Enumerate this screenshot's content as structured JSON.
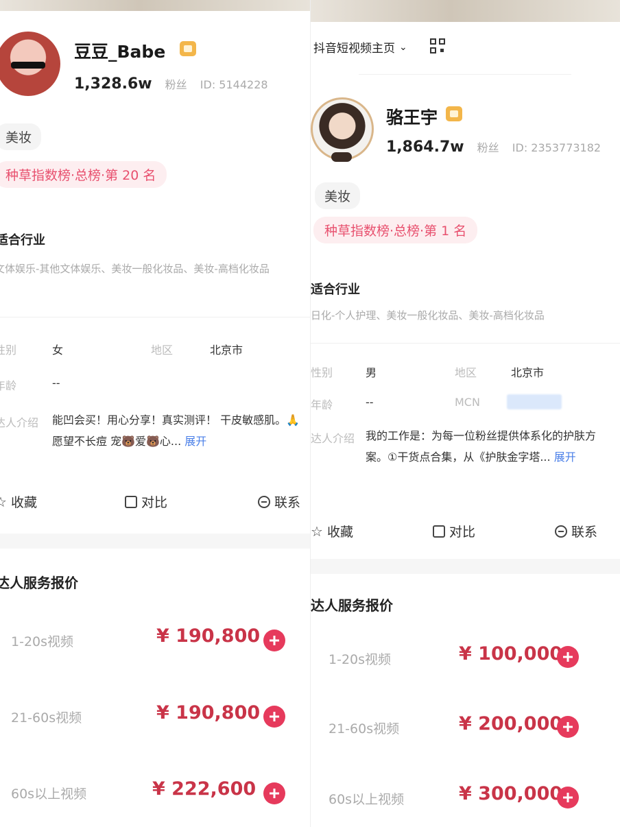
{
  "left": {
    "name": "豆豆_Babe",
    "fans_count": "1,328.6w",
    "fans_label": "粉丝",
    "id_text": "ID: 5144228",
    "category_tag": "美妆",
    "rank_badge": "种草指数榜·总榜·第 20 名",
    "industry_title": "适合行业",
    "industry_text": "文体娱乐-其他文体娱乐、美妆一般化妆品、美妆-高档化妆品",
    "info": {
      "gender_label": "性别",
      "gender_value": "女",
      "region_label": "地区",
      "region_value": "北京市",
      "age_label": "年龄",
      "age_value": "--",
      "intro_label": "达人介绍",
      "intro_text": "能凹会买！用心分享！真实测评！ 干皮敏感肌。🙏愿望不长痘 宠🐻爱🐻心...",
      "expand": "展开"
    },
    "actions": {
      "collect": "收藏",
      "compare": "对比",
      "contact": "联系"
    },
    "pricing_title": "达人服务报价",
    "prices": [
      {
        "label": "1-20s视频",
        "value": "¥ 190,800"
      },
      {
        "label": "21-60s视频",
        "value": "¥ 190,800"
      },
      {
        "label": "60s以上视频",
        "value": "¥ 222,600"
      }
    ]
  },
  "right": {
    "nav_title": "抖音短视频主页",
    "name": "骆王宇",
    "fans_count": "1,864.7w",
    "fans_label": "粉丝",
    "id_text": "ID: 2353773182",
    "category_tag": "美妆",
    "rank_badge": "种草指数榜·总榜·第 1 名",
    "industry_title": "适合行业",
    "industry_text": "日化-个人护理、美妆一般化妆品、美妆-高档化妆品",
    "info": {
      "gender_label": "性别",
      "gender_value": "男",
      "region_label": "地区",
      "region_value": "北京市",
      "age_label": "年龄",
      "age_value": "--",
      "mcn_label": "MCN",
      "intro_label": "达人介绍",
      "intro_text": "我的工作是：为每一位粉丝提供体系化的护肤方案。①干货点合集，从《护肤金字塔...",
      "expand": "展开"
    },
    "actions": {
      "collect": "收藏",
      "compare": "对比",
      "contact": "联系"
    },
    "pricing_title": "达人服务报价",
    "prices": [
      {
        "label": "1-20s视频",
        "value": "¥ 100,000"
      },
      {
        "label": "21-60s视频",
        "value": "¥ 200,000"
      },
      {
        "label": "60s以上视频",
        "value": "¥ 300,000"
      }
    ]
  },
  "colors": {
    "accent": "#e63a5c",
    "price": "#c93448",
    "rank_text": "#e8506e",
    "rank_bg": "#fdeef0",
    "link": "#4a7fe8",
    "vip": "#f3b64a"
  },
  "icons": [
    "star-icon",
    "compare-icon",
    "chat-icon",
    "plus-icon",
    "qr-code-icon",
    "vip-badge-icon",
    "chevron-down-icon"
  ]
}
